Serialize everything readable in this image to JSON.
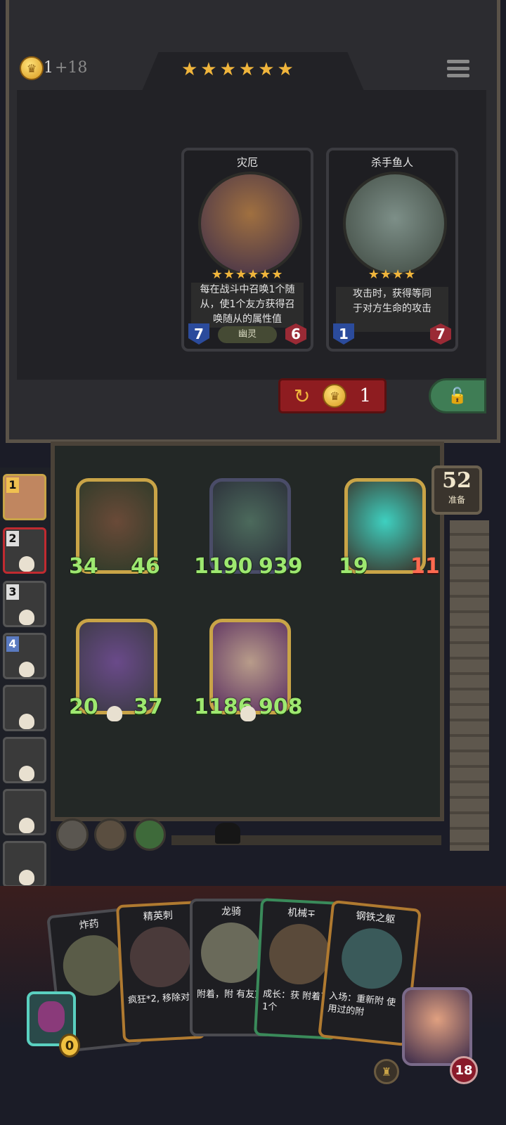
{
  "top": {
    "gold": "1",
    "gold_income": "+18",
    "tier_stars": "★★★★★★"
  },
  "shop": {
    "cards": [
      {
        "name": "灾厄",
        "stars": "★★★★★★",
        "desc_line1": "每在战斗中召唤1个随",
        "desc_line2": "从，使1个友方获得召",
        "desc_line3": "唤随从的属性值",
        "attack": "7",
        "health": "6",
        "tribe": "幽灵"
      },
      {
        "name": "杀手鱼人",
        "stars": "★★★★",
        "desc_line1": "攻击时，获得等同",
        "desc_line2": "于对方生命的攻击",
        "desc_line3": "",
        "attack": "1",
        "health": "7",
        "tribe": ""
      }
    ],
    "reroll_cost": "1"
  },
  "board": {
    "ready_count": "52",
    "ready_label": "准备",
    "minions": [
      {
        "attack": "34",
        "health": "46"
      },
      {
        "attack": "1190",
        "health": "939"
      },
      {
        "attack": "19",
        "health": "11"
      },
      {
        "attack": "20",
        "health": "37"
      },
      {
        "attack": "1186",
        "health": "908"
      }
    ]
  },
  "players": [
    {
      "rank": "1"
    },
    {
      "rank": "2"
    },
    {
      "rank": "3"
    },
    {
      "rank": "4"
    }
  ],
  "hand": {
    "cards": [
      {
        "name": "炸药",
        "desc": ""
      },
      {
        "name": "精英刺",
        "desc": "疯狂*2, 移除对"
      },
      {
        "name": "龙骑",
        "desc": "附着，附 有友方"
      },
      {
        "name": "机械∓",
        "desc": "成长：获 附着了1个"
      },
      {
        "name": "钢铁之躯",
        "desc": "入场：重新附 使用过的附"
      }
    ],
    "trinket_count": "0",
    "hero_health": "18"
  }
}
